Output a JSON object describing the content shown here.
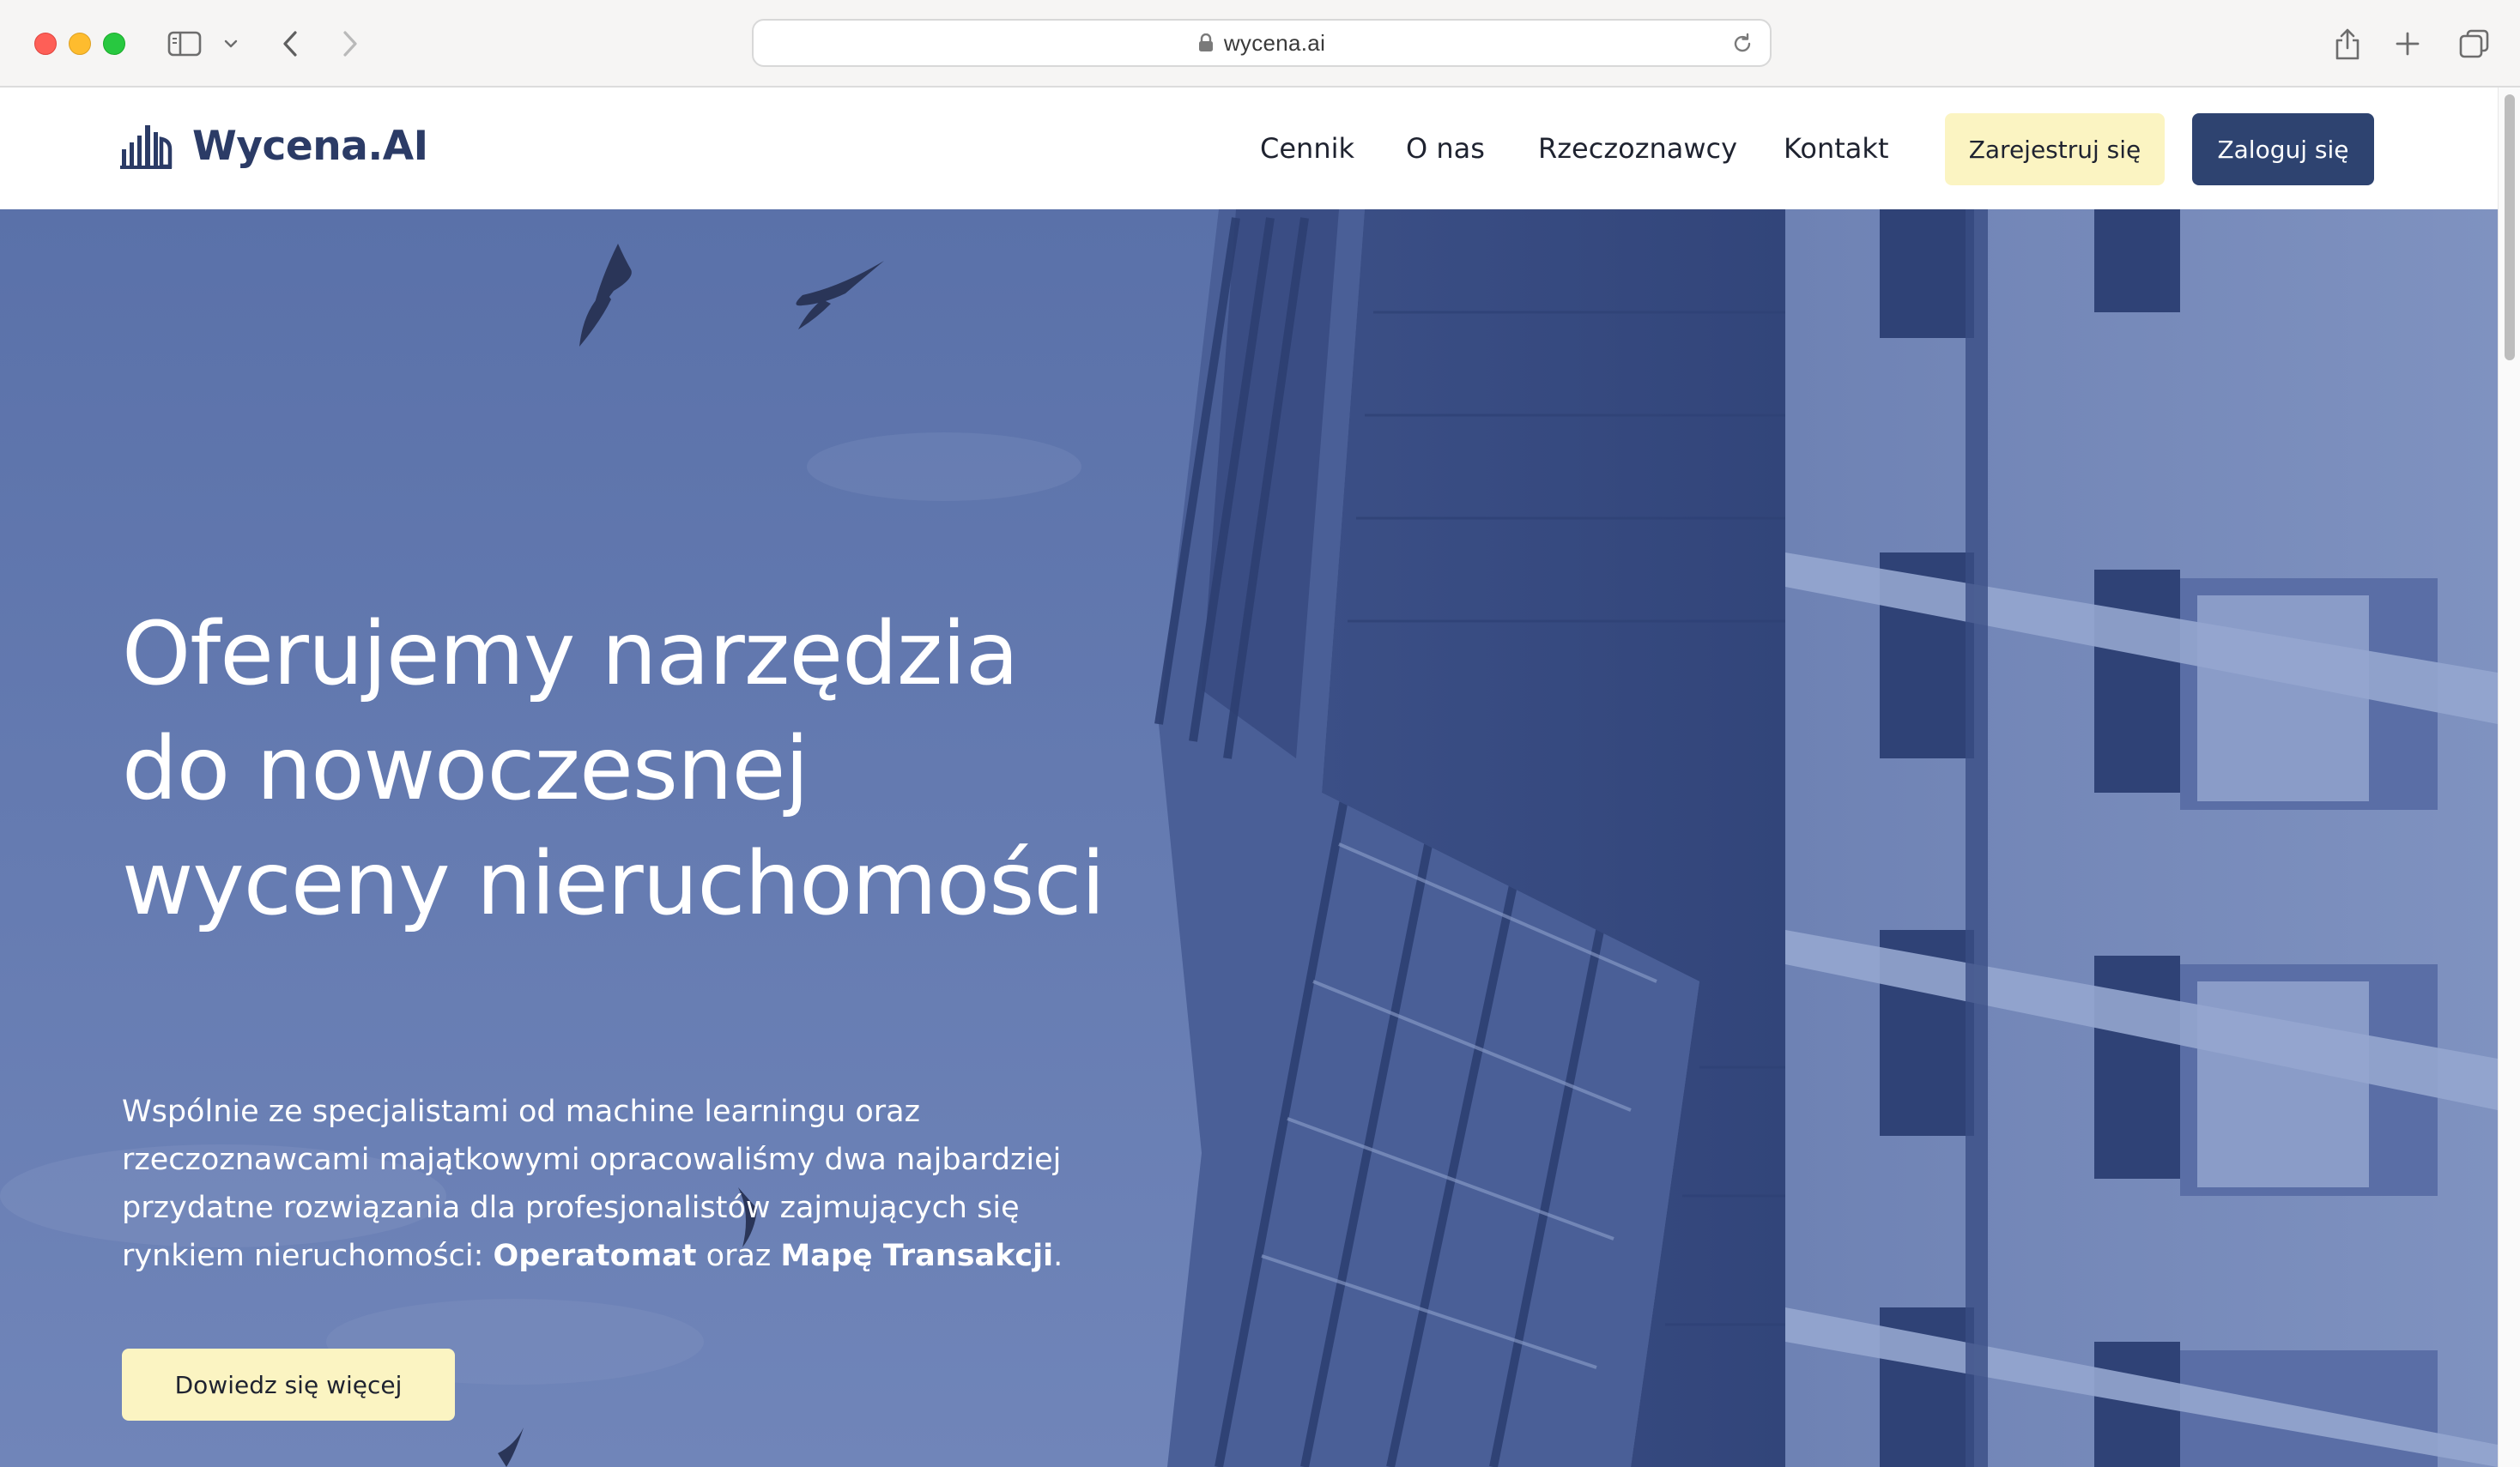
{
  "browser": {
    "url": "wycena.ai"
  },
  "header": {
    "logo_text": "Wycena.AI",
    "nav": [
      {
        "label": "Cennik"
      },
      {
        "label": "O nas"
      },
      {
        "label": "Rzeczoznawcy"
      },
      {
        "label": "Kontakt"
      }
    ],
    "register_label": "Zarejestruj się",
    "login_label": "Zaloguj się"
  },
  "hero": {
    "title": "Oferujemy narzędzia do nowoczesnej wyceny nieruchomości",
    "description": {
      "intro": "Wspólnie ze specjalistami od machine learningu oraz rzeczoznawcami majątkowymi opracowaliśmy dwa najbardziej przydatne rozwiązania dla profesjonalistów zajmujących się rynkiem nieruchomości: ",
      "product1": "Operatomat",
      "connector": " oraz ",
      "product2": "Mapę Transakcji",
      "ending": "."
    },
    "cta_label": "Dowiedz się więcej"
  },
  "colors": {
    "brand_navy": "#2e4370",
    "accent_yellow": "#fbf4c2",
    "hero_blue": "#6a80b6",
    "logo_navy": "#2b3b66"
  }
}
